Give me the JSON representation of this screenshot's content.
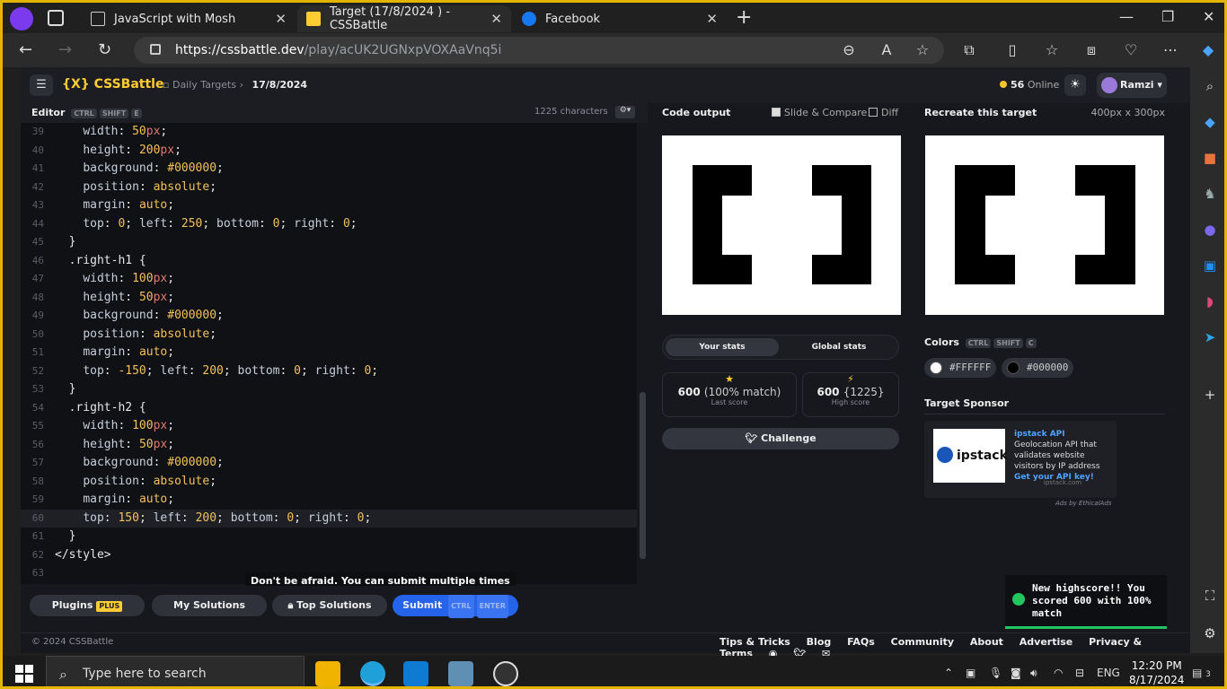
{
  "browser": {
    "tabs": [
      {
        "title": "JavaScript with Mosh"
      },
      {
        "title": "Target (17/8/2024 ) - CSSBattle"
      },
      {
        "title": "Facebook"
      }
    ],
    "url_domain": "https://cssbattle.dev",
    "url_path": "/play/acUK2UGNxpVOXAaVnq5i"
  },
  "site": {
    "logo": "{X} CSSBattle",
    "breadcrumb_section": "Daily Targets",
    "breadcrumb_date": "17/8/2024",
    "online_count": "56",
    "online_label": "Online",
    "user_name": "Ramzi"
  },
  "editor": {
    "title": "Editor",
    "shortcut": [
      "CTRL",
      "SHIFT",
      "E"
    ],
    "char_count": "1225 characters",
    "lines": [
      {
        "n": "39",
        "code": "    width: 50px;"
      },
      {
        "n": "40",
        "code": "    height: 200px;"
      },
      {
        "n": "41",
        "code": "    background: #000000;"
      },
      {
        "n": "42",
        "code": "    position: absolute;"
      },
      {
        "n": "43",
        "code": "    margin: auto;"
      },
      {
        "n": "44",
        "code": "    top: 0; left: 250; bottom: 0; right: 0;"
      },
      {
        "n": "45",
        "code": "  }"
      },
      {
        "n": "46",
        "code": "  .right-h1 {"
      },
      {
        "n": "47",
        "code": "    width: 100px;"
      },
      {
        "n": "48",
        "code": "    height: 50px;"
      },
      {
        "n": "49",
        "code": "    background: #000000;"
      },
      {
        "n": "50",
        "code": "    position: absolute;"
      },
      {
        "n": "51",
        "code": "    margin: auto;"
      },
      {
        "n": "52",
        "code": "    top: -150; left: 200; bottom: 0; right: 0;"
      },
      {
        "n": "53",
        "code": "  }"
      },
      {
        "n": "54",
        "code": "  .right-h2 {"
      },
      {
        "n": "55",
        "code": "    width: 100px;"
      },
      {
        "n": "56",
        "code": "    height: 50px;"
      },
      {
        "n": "57",
        "code": "    background: #000000;"
      },
      {
        "n": "58",
        "code": "    position: absolute;"
      },
      {
        "n": "59",
        "code": "    margin: auto;"
      },
      {
        "n": "60",
        "code": "    top: 150; left: 200; bottom: 0; right: 0;"
      },
      {
        "n": "61",
        "code": "  }"
      },
      {
        "n": "62",
        "code": "</style>"
      },
      {
        "n": "63",
        "code": ""
      }
    ],
    "highlighted_line": "60",
    "tooltip": "Don't be afraid. You can submit multiple times",
    "buttons": {
      "plugins": "Plugins",
      "plugins_badge": "PLUS",
      "my_solutions": "My Solutions",
      "top_solutions": "Top Solutions",
      "submit": "Submit",
      "submit_keys": [
        "CTRL",
        "ENTER"
      ]
    }
  },
  "output": {
    "title": "Code output",
    "slide_compare": "Slide & Compare",
    "diff": "Diff",
    "stats_tabs": [
      "Your stats",
      "Global stats"
    ],
    "last_score_value": "600",
    "last_score_detail": "(100% match)",
    "last_score_label": "Last score",
    "high_score_value": "600",
    "high_score_detail": "{1225}",
    "high_score_label": "High score",
    "challenge": "Challenge"
  },
  "target": {
    "title": "Recreate this target",
    "size": "400px x 300px",
    "colors_title": "Colors",
    "colors_shortcut": [
      "CTRL",
      "SHIFT",
      "C"
    ],
    "colors": [
      "#FFFFFF",
      "#000000"
    ],
    "sponsor_title": "Target Sponsor",
    "ad_brand": "ipstack",
    "ad_text_strong": "ipstack API",
    "ad_text": "Geolocation API that validates website visitors by IP address",
    "ad_cta": "Get your API key!",
    "ad_source": "ipstack.com",
    "ads_by": "Ads by EthicalAds"
  },
  "toast": {
    "message": "New highscore!! You scored 600 with 100% match"
  },
  "footer": {
    "copyright": "© 2024 CSSBattle",
    "links": [
      "Tips & Tricks",
      "Blog",
      "FAQs",
      "Community",
      "About",
      "Advertise",
      "Privacy & Terms"
    ]
  },
  "taskbar": {
    "search_placeholder": "Type here to search",
    "language": "ENG",
    "time": "12:20 PM",
    "date": "8/17/2024",
    "notifications": "3"
  },
  "colors": {
    "accent": "#ffcc33",
    "submit": "#2563eb",
    "success": "#22c55e"
  }
}
